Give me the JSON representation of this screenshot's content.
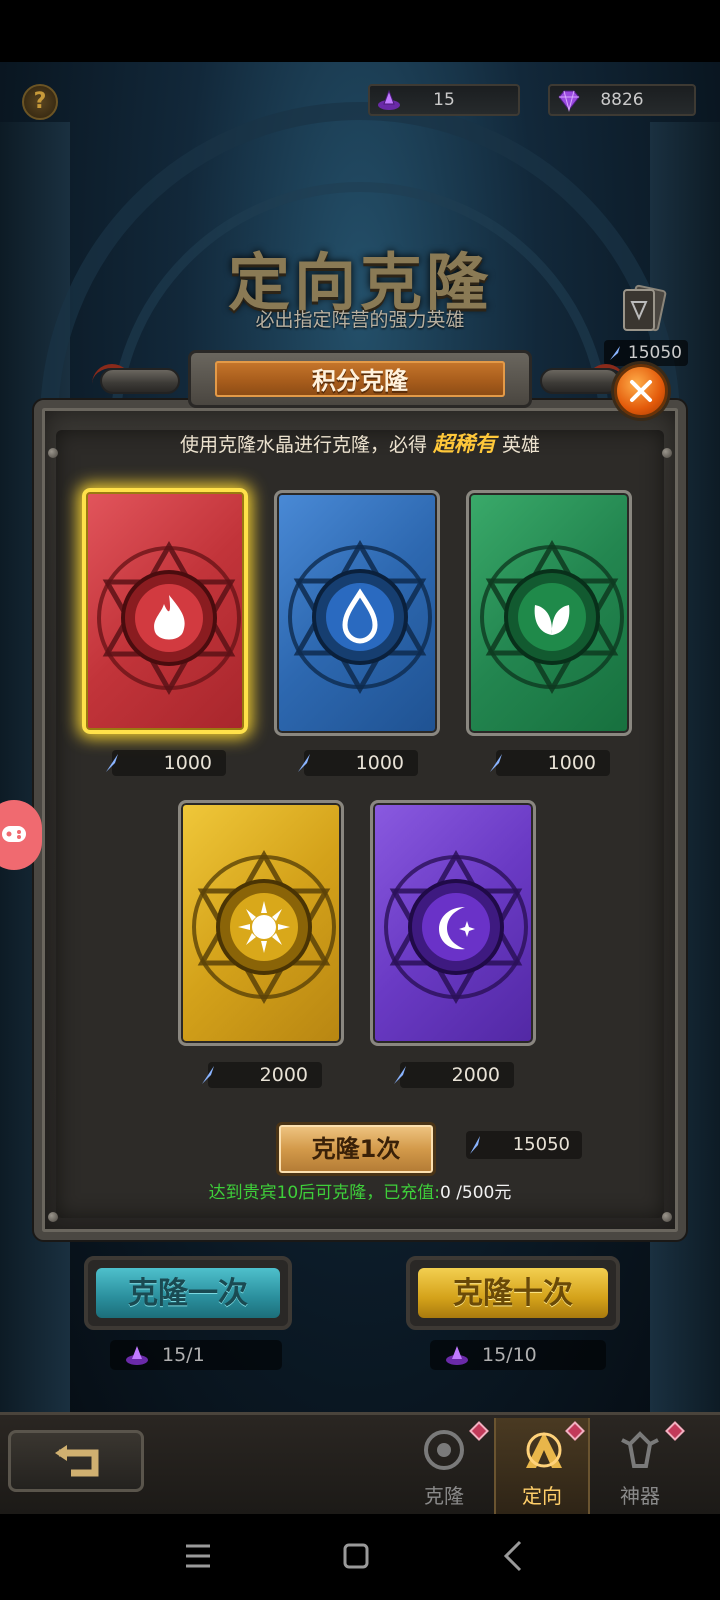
{
  "header": {
    "help_icon": "question-mark",
    "resource_crystal": {
      "icon": "purple-crystal-icon",
      "value": "15"
    },
    "resource_gem": {
      "icon": "purple-gem-icon",
      "value": "8826"
    },
    "title": "定向克隆",
    "subtitle": "必出指定阵营的强力英雄",
    "cards_count": "15050"
  },
  "modal": {
    "banner": "积分克隆",
    "desc_prefix": "使用克隆水晶进行克隆，必得",
    "desc_highlight": "超稀有",
    "desc_suffix": "英雄",
    "cards": [
      {
        "element": "fire",
        "color": "red",
        "cost": "1000",
        "selected": true
      },
      {
        "element": "water",
        "color": "blue",
        "cost": "1000",
        "selected": false
      },
      {
        "element": "nature",
        "color": "green",
        "cost": "1000",
        "selected": false
      },
      {
        "element": "light",
        "color": "gold",
        "cost": "2000",
        "selected": false
      },
      {
        "element": "dark",
        "color": "purple",
        "cost": "2000",
        "selected": false
      }
    ],
    "clone_button": "克隆1次",
    "clone_cost": "15050",
    "vip_note_green": "达到贵宾10后可克隆，已充值:",
    "vip_note_white": "0 /500元"
  },
  "actions": {
    "clone_once": "克隆一次",
    "clone_ten": "克隆十次",
    "once_count": "15/1",
    "ten_count": "15/10"
  },
  "bottom_tabs": [
    {
      "label": "克隆",
      "icon": "clone-icon",
      "active": false
    },
    {
      "label": "定向",
      "icon": "direction-icon",
      "active": true
    },
    {
      "label": "神器",
      "icon": "artifact-icon",
      "active": false
    }
  ],
  "colors": {
    "accent_orange": "#c7772c",
    "highlight_gold": "#ffc83a",
    "vip_green": "#3ecf3a"
  }
}
